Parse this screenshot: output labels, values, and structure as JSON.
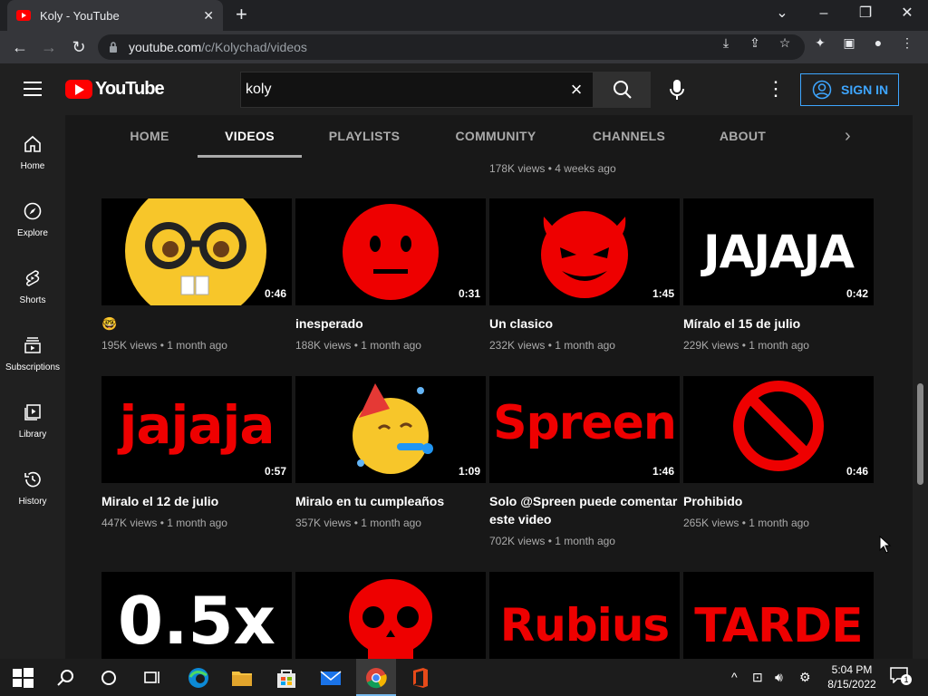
{
  "browser": {
    "tab_title": "Koly - YouTube",
    "url_host": "youtube.com",
    "url_path": "/c/Kolychad/videos"
  },
  "header": {
    "logo_text": "YouTube",
    "search_value": "koly",
    "signin_label": "SIGN IN"
  },
  "channel_tabs": [
    "HOME",
    "VIDEOS",
    "PLAYLISTS",
    "COMMUNITY",
    "CHANNELS",
    "ABOUT"
  ],
  "sidebar": [
    {
      "label": "Home",
      "icon": "home-icon"
    },
    {
      "label": "Explore",
      "icon": "compass-icon"
    },
    {
      "label": "Shorts",
      "icon": "shorts-icon"
    },
    {
      "label": "Subscriptions",
      "icon": "subscriptions-icon"
    },
    {
      "label": "Library",
      "icon": "library-icon"
    },
    {
      "label": "History",
      "icon": "history-icon"
    }
  ],
  "prev_row_meta": "178K views • 4 weeks ago",
  "videos": [
    {
      "title": "🤓",
      "views": "195K views",
      "age": "1 month ago",
      "duration": "0:46"
    },
    {
      "title": "inesperado",
      "views": "188K views",
      "age": "1 month ago",
      "duration": "0:31"
    },
    {
      "title": "Un clasico",
      "views": "232K views",
      "age": "1 month ago",
      "duration": "1:45"
    },
    {
      "title": "Míralo el 15 de julio",
      "views": "229K views",
      "age": "1 month ago",
      "duration": "0:42",
      "thumb_text": "JAJAJA"
    },
    {
      "title": "Miralo el 12 de julio",
      "views": "447K views",
      "age": "1 month ago",
      "duration": "0:57",
      "thumb_text": "jajaja"
    },
    {
      "title": "Miralo en tu cumpleaños",
      "views": "357K views",
      "age": "1 month ago",
      "duration": "1:09"
    },
    {
      "title": "Solo @Spreen puede comentar este video",
      "views": "702K views",
      "age": "1 month ago",
      "duration": "1:46",
      "thumb_text": "Spreen"
    },
    {
      "title": "Prohibido",
      "views": "265K views",
      "age": "1 month ago",
      "duration": "0:46"
    },
    {
      "thumb_text": "0.5x"
    },
    {
      "thumb_text": ""
    },
    {
      "thumb_text": "Rubius"
    },
    {
      "thumb_text": "TARDE"
    }
  ],
  "taskbar": {
    "time": "5:04 PM",
    "date": "8/15/2022",
    "notification_count": "1"
  },
  "colors": {
    "accent_red": "#ff0000",
    "link_blue": "#3ea6ff"
  }
}
